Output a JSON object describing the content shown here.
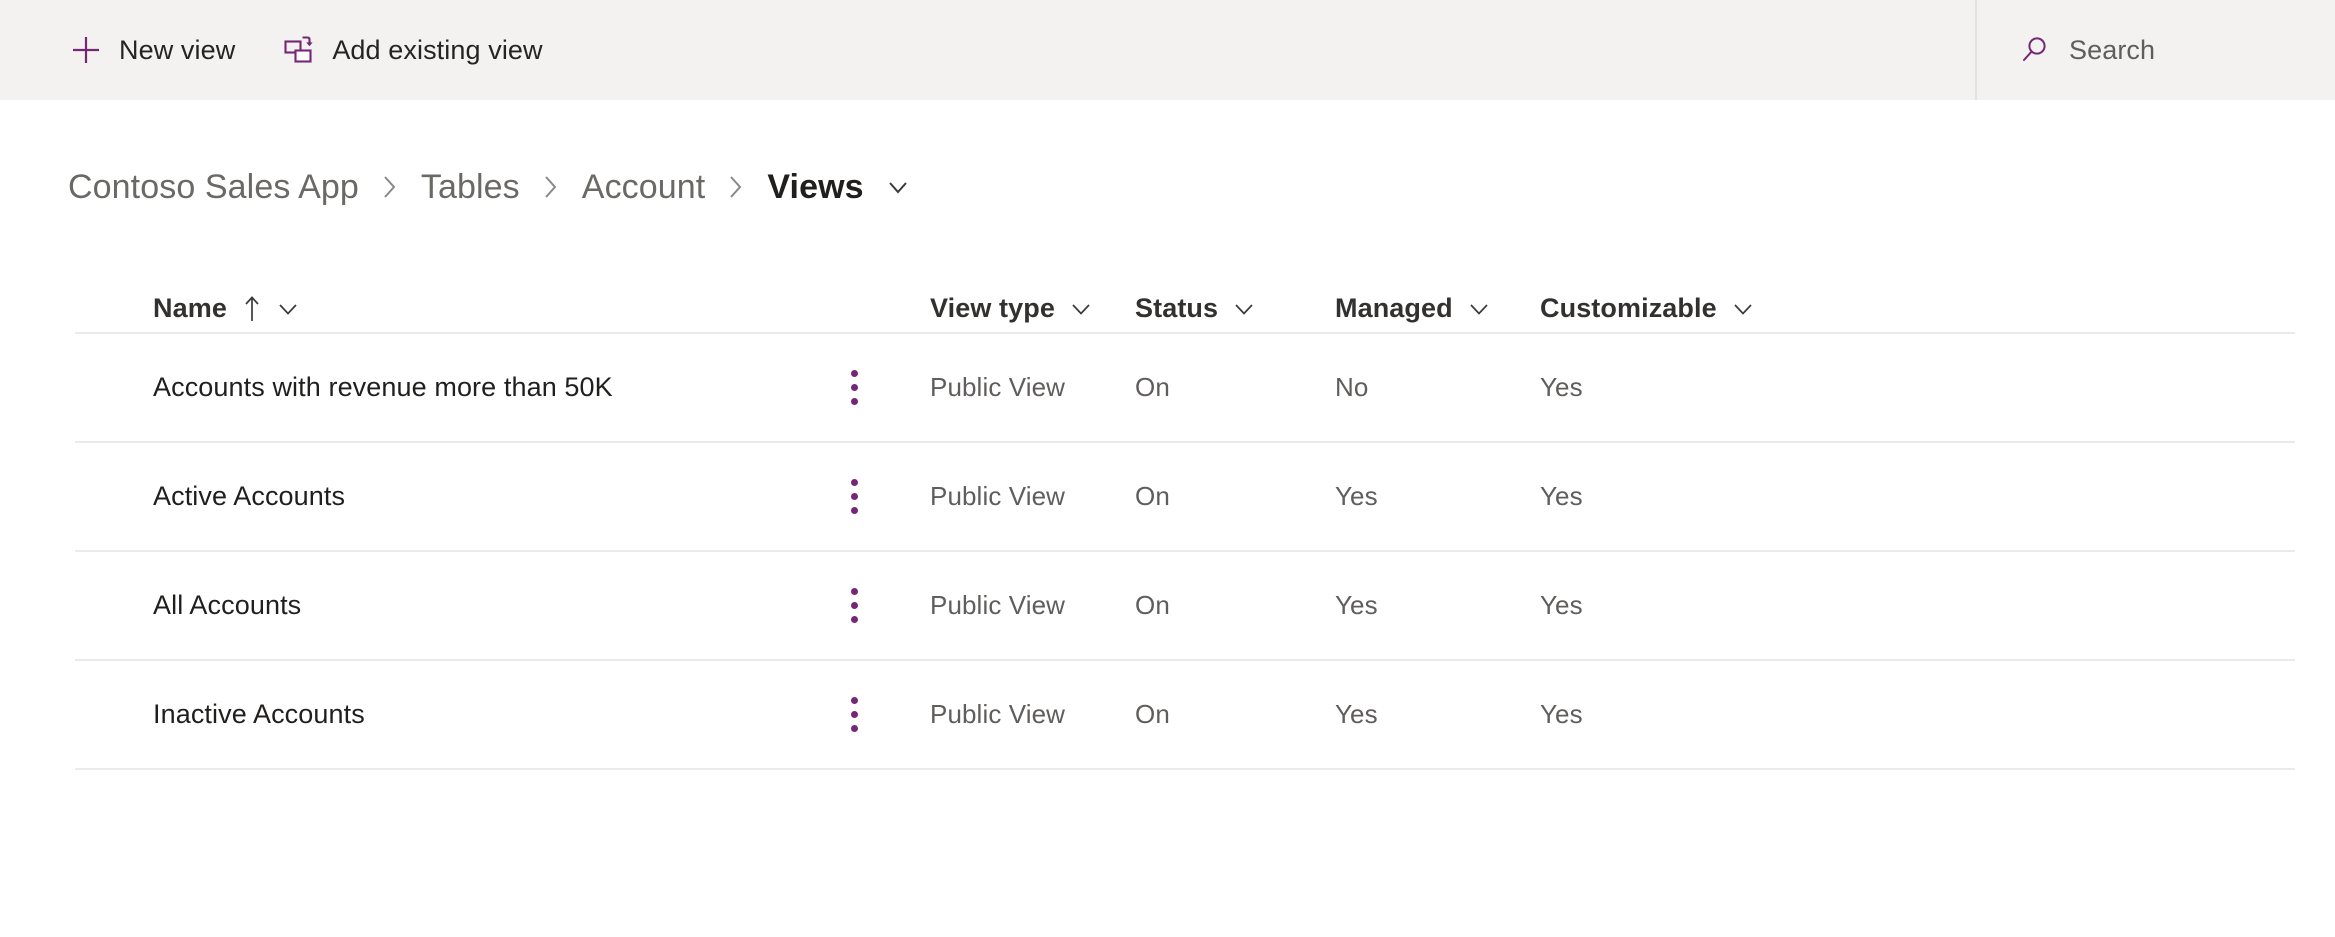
{
  "command_bar": {
    "actions": [
      {
        "label": "New view",
        "icon": "plus-icon"
      },
      {
        "label": "Add existing view",
        "icon": "add-existing-view-icon"
      }
    ],
    "search": {
      "icon": "search-icon",
      "placeholder": "Search",
      "value": ""
    }
  },
  "breadcrumb": {
    "items": [
      {
        "label": "Contoso Sales App",
        "current": false
      },
      {
        "label": "Tables",
        "current": false
      },
      {
        "label": "Account",
        "current": false
      },
      {
        "label": "Views",
        "current": true
      }
    ],
    "separator_icon": "chevron-right-icon",
    "dropdown_icon": "chevron-down-icon"
  },
  "table": {
    "columns": [
      {
        "label": "Name",
        "sorted": "ascending",
        "sort_icon": "arrow-up-icon",
        "menu_icon": "chevron-down-icon"
      },
      {
        "label": "View type",
        "menu_icon": "chevron-down-icon"
      },
      {
        "label": "Status",
        "menu_icon": "chevron-down-icon"
      },
      {
        "label": "Managed",
        "menu_icon": "chevron-down-icon"
      },
      {
        "label": "Customizable",
        "menu_icon": "chevron-down-icon"
      }
    ],
    "row_menu_icon": "more-vertical-icon",
    "rows": [
      {
        "name": "Accounts with revenue more than 50K",
        "view_type": "Public View",
        "status": "On",
        "managed": "No",
        "customizable": "Yes"
      },
      {
        "name": "Active Accounts",
        "view_type": "Public View",
        "status": "On",
        "managed": "Yes",
        "customizable": "Yes"
      },
      {
        "name": "All Accounts",
        "view_type": "Public View",
        "status": "On",
        "managed": "Yes",
        "customizable": "Yes"
      },
      {
        "name": "Inactive Accounts",
        "view_type": "Public View",
        "status": "On",
        "managed": "Yes",
        "customizable": "Yes"
      }
    ]
  },
  "colors": {
    "accent_purple": "#742774",
    "command_bar_bg": "#f3f2f1",
    "text_primary": "#201f1e",
    "text_secondary": "#605e5c",
    "border": "#ebeaea"
  }
}
